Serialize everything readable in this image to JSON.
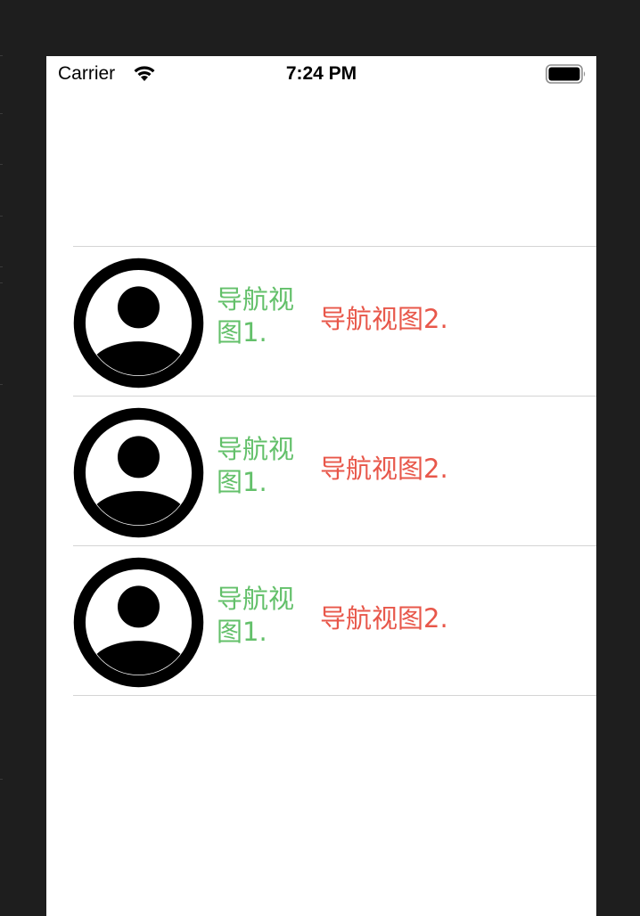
{
  "status_bar": {
    "carrier": "Carrier",
    "time": "7:24 PM",
    "wifi_icon": "wifi-icon",
    "battery_icon": "battery-icon"
  },
  "colors": {
    "left_label": "#63c06a",
    "right_label": "#e8574a",
    "separator": "#d4d4d4",
    "background": "#ffffff"
  },
  "rows": [
    {
      "avatar_icon": "person-circle-icon",
      "left_label": "导航视图1.",
      "right_label": "导航视图2."
    },
    {
      "avatar_icon": "person-circle-icon",
      "left_label": "导航视图1.",
      "right_label": "导航视图2."
    },
    {
      "avatar_icon": "person-circle-icon",
      "left_label": "导航视图1.",
      "right_label": "导航视图2."
    }
  ]
}
